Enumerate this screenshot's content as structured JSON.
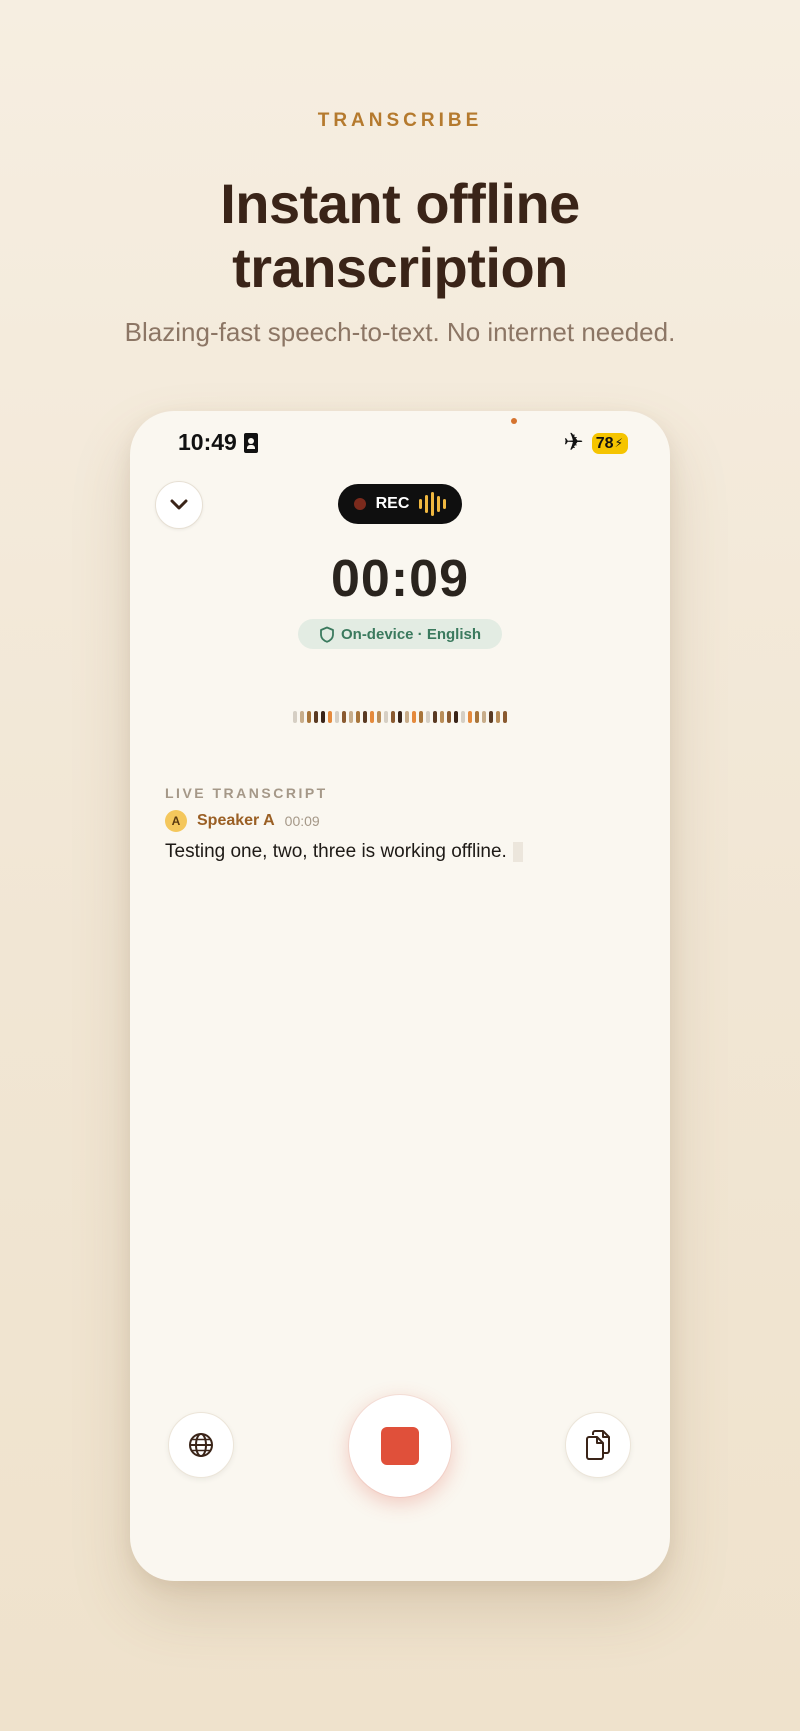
{
  "promo": {
    "eyebrow": "TRANSCRIBE",
    "headline_line1": "Instant offline",
    "headline_line2": "transcription",
    "subheadline": "Blazing-fast speech-to-text. No internet needed."
  },
  "status_bar": {
    "time": "10:49",
    "battery": "78",
    "airplane_mode": true
  },
  "recorder": {
    "collapse_icon": "chevron-down-icon",
    "rec_label": "REC",
    "timer": "00:09",
    "privacy_badge": "On-device · English",
    "live_label": "LIVE TRANSCRIPT",
    "segments": [
      {
        "avatar": "A",
        "speaker": "Speaker A",
        "time": "00:09",
        "text": "Testing one, two, three is working offline."
      }
    ]
  },
  "controls": {
    "language_icon": "globe-icon",
    "stop_icon": "stop-icon",
    "copy_icon": "copy-icon"
  },
  "colors": {
    "accent": "#b57a2e",
    "headline": "#3a2418",
    "stop": "#e0503a",
    "privacy_green": "#3b7a5e",
    "battery": "#f5c400"
  }
}
